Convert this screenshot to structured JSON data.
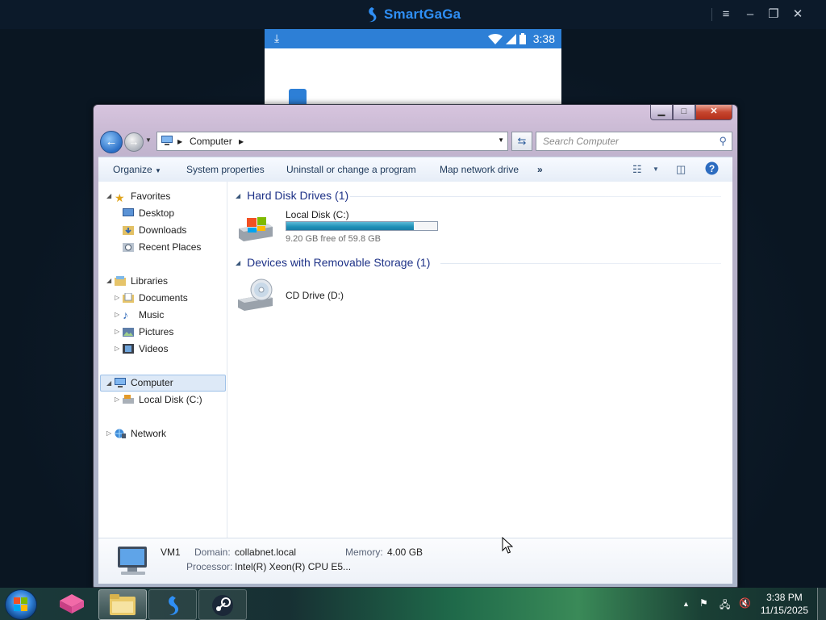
{
  "emulator": {
    "brand": "SmartGaGa",
    "phone_time": "3:38"
  },
  "window": {
    "address": {
      "crumbs": [
        "Computer"
      ]
    },
    "search_placeholder": "Search Computer",
    "toolbar": {
      "organize": "Organize",
      "system_properties": "System properties",
      "uninstall": "Uninstall or change a program",
      "map_drive": "Map network drive",
      "more": "»"
    },
    "nav": {
      "favorites": "Favorites",
      "desktop": "Desktop",
      "downloads": "Downloads",
      "recent_places": "Recent Places",
      "libraries": "Libraries",
      "documents": "Documents",
      "music": "Music",
      "pictures": "Pictures",
      "videos": "Videos",
      "computer": "Computer",
      "local_disk": "Local Disk (C:)",
      "network": "Network"
    },
    "groups": {
      "hdd": "Hard Disk Drives (1)",
      "removable": "Devices with Removable Storage (1)"
    },
    "drives": {
      "c_label": "Local Disk (C:)",
      "c_free": "9.20 GB free of 59.8 GB",
      "c_used_fraction": 0.846,
      "d_label": "CD Drive (D:)"
    },
    "details": {
      "name": "VM1",
      "domain_label": "Domain:",
      "domain": "collabnet.local",
      "memory_label": "Memory:",
      "memory": "4.00 GB",
      "processor_label": "Processor:",
      "processor": "Intel(R) Xeon(R) CPU E5..."
    }
  },
  "taskbar": {
    "time": "3:38 PM",
    "date": "11/15/2025"
  },
  "colors": {
    "emulator_brand": "#2f8ff5",
    "phone_bar": "#2d7fd6",
    "group_heading": "#1e3287",
    "disk_fill": "#1d8fb6"
  }
}
